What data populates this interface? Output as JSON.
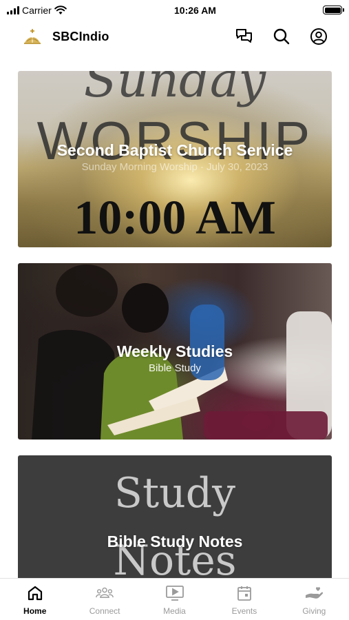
{
  "status_bar": {
    "carrier": "Carrier",
    "time": "10:26 AM"
  },
  "header": {
    "app_title": "SBCIndio",
    "icons": [
      "logo-icon",
      "chat-icon",
      "search-icon",
      "profile-icon"
    ]
  },
  "feed": {
    "cards": [
      {
        "title": "Second Baptist Church Service",
        "subtitle": "Sunday Morning Worship · July 30, 2023",
        "image_text": [
          "Sunday",
          "WORSHIP",
          "10:00 AM"
        ]
      },
      {
        "title": "Weekly Studies",
        "subtitle": "Bible Study"
      },
      {
        "title": "Bible Study Notes",
        "image_text": [
          "Study",
          "Notes"
        ]
      }
    ]
  },
  "tab_bar": {
    "tabs": [
      {
        "label": "Home",
        "icon": "home-icon",
        "active": true
      },
      {
        "label": "Connect",
        "icon": "people-icon",
        "active": false
      },
      {
        "label": "Media",
        "icon": "media-icon",
        "active": false
      },
      {
        "label": "Events",
        "icon": "calendar-icon",
        "active": false
      },
      {
        "label": "Giving",
        "icon": "giving-icon",
        "active": false
      }
    ]
  },
  "colors": {
    "active_tab": "#000000",
    "inactive_tab": "#9a9a9a",
    "notes_card_bg": "#3d3d3d"
  }
}
